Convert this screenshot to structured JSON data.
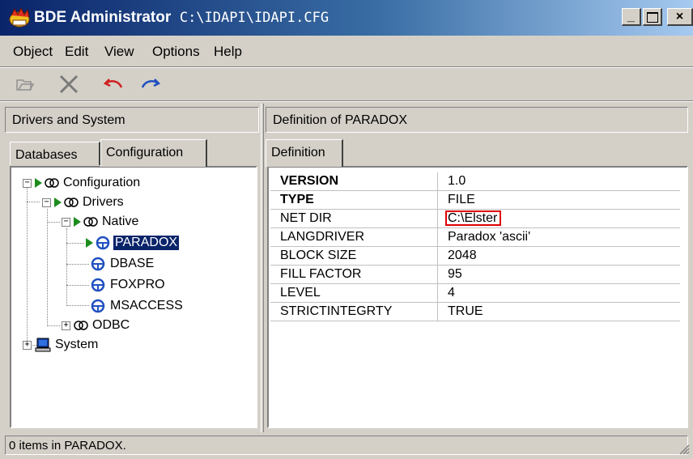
{
  "window": {
    "title_app": "BDE Administrator",
    "title_path": "C:\\IDAPI\\IDAPI.CFG",
    "buttons": {
      "minimize": "_",
      "maximize": "□",
      "close": "×"
    }
  },
  "menu": [
    {
      "label": "Object"
    },
    {
      "label": "Edit"
    },
    {
      "label": "View"
    },
    {
      "label": "Options"
    },
    {
      "label": "Help"
    }
  ],
  "toolbar": {
    "icons": [
      "open-icon",
      "delete-icon",
      "undo-icon",
      "redo-icon"
    ]
  },
  "left_pane": {
    "header": "Drivers and System",
    "tabs": [
      {
        "label": "Databases",
        "active": false
      },
      {
        "label": "Configuration",
        "active": true
      }
    ],
    "tree": [
      {
        "label": "Configuration"
      },
      {
        "label": "Drivers"
      },
      {
        "label": "Native"
      },
      {
        "label": "PARADOX",
        "selected": true
      },
      {
        "label": "DBASE"
      },
      {
        "label": "FOXPRO"
      },
      {
        "label": "MSACCESS"
      },
      {
        "label": "ODBC"
      },
      {
        "label": "System"
      }
    ]
  },
  "right_pane": {
    "header": "Definition of PARADOX",
    "tab": "Definition",
    "rows": [
      {
        "key": "VERSION",
        "value": "1.0",
        "bold": true
      },
      {
        "key": "TYPE",
        "value": "FILE",
        "bold": true
      },
      {
        "key": "NET DIR",
        "value": "C:\\Elster",
        "highlight": true,
        "highlight_color": "#e00000"
      },
      {
        "key": "LANGDRIVER",
        "value": "Paradox 'ascii'"
      },
      {
        "key": "BLOCK SIZE",
        "value": "2048"
      },
      {
        "key": "FILL FACTOR",
        "value": "95"
      },
      {
        "key": "LEVEL",
        "value": "4"
      },
      {
        "key": "STRICTINTEGRTY",
        "value": "TRUE"
      }
    ]
  },
  "status_bar": {
    "text": "0 items in PARADOX."
  },
  "colors": {
    "titlebar_start": "#0a246a",
    "titlebar_end": "#a6caf0",
    "face": "#d4d0c8",
    "selection": "#0a246a",
    "node_green": "#1c8c1c"
  }
}
